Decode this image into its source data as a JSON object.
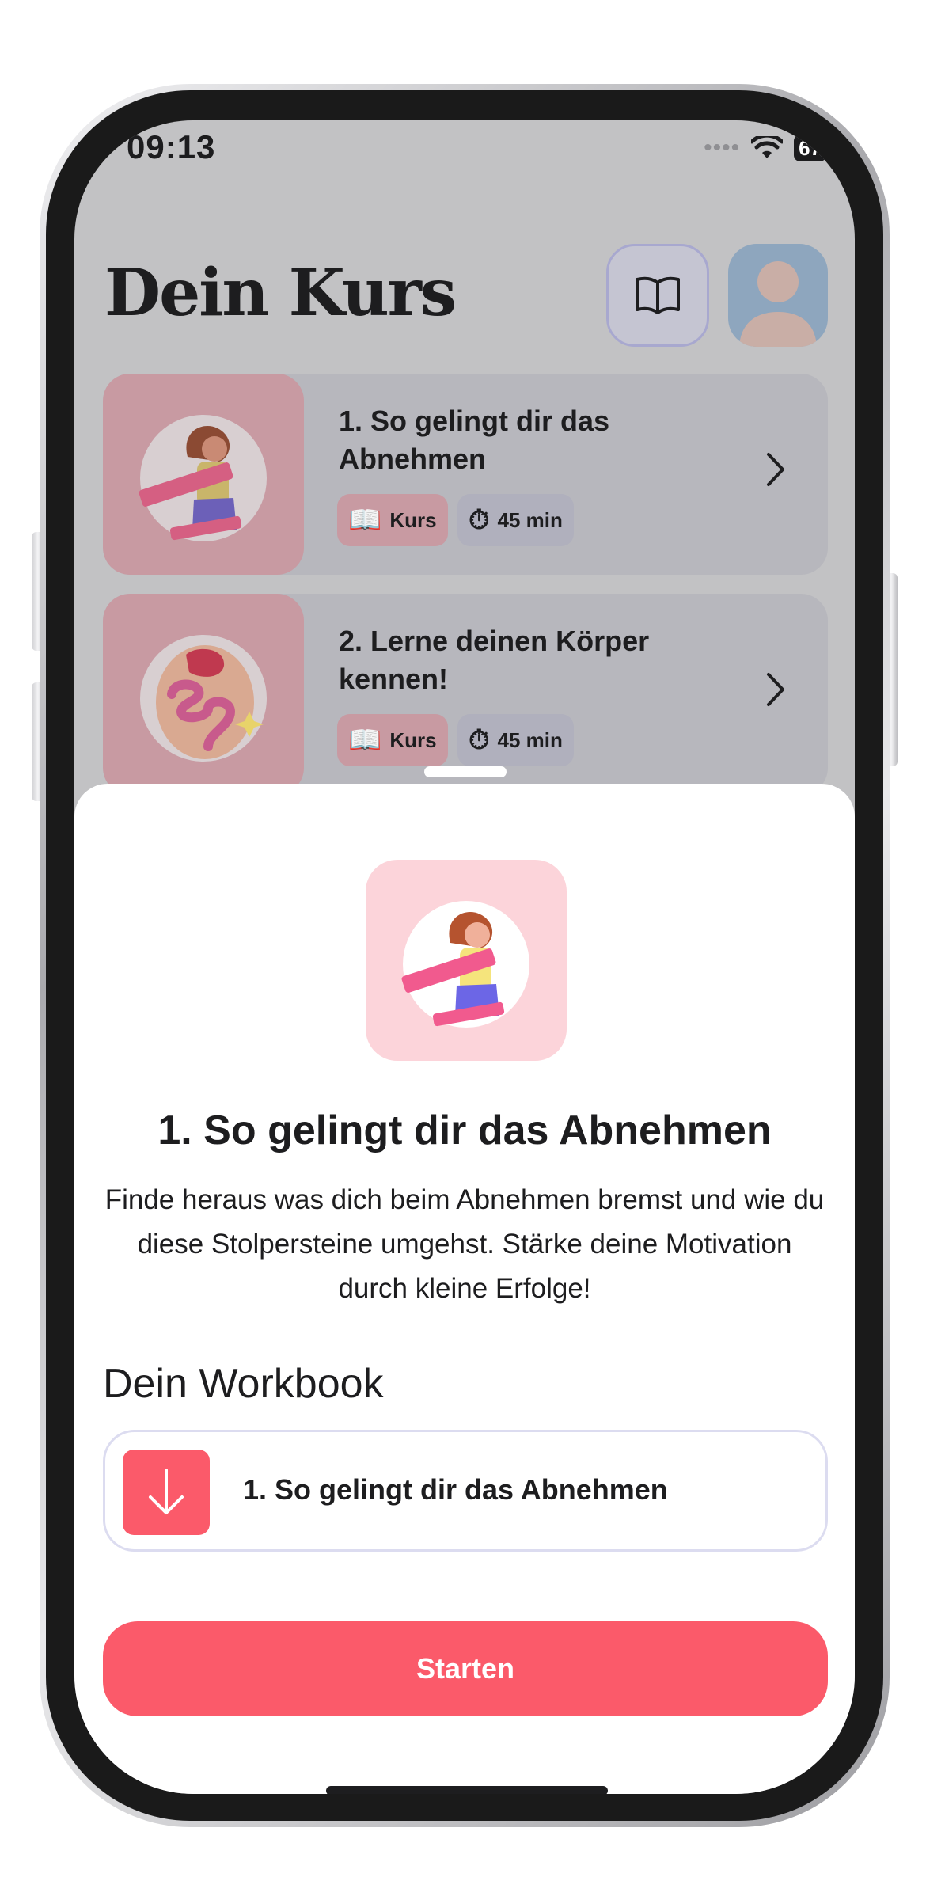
{
  "status": {
    "time": "09:13",
    "battery": "67"
  },
  "header": {
    "title": "Dein Kurs"
  },
  "courses": [
    {
      "title": "1. So gelingt dir das Abnehmen",
      "type_label": "Kurs",
      "duration": "45 min"
    },
    {
      "title": "2. Lerne deinen Körper kennen!",
      "type_label": "Kurs",
      "duration": "45 min"
    }
  ],
  "sheet": {
    "title": "1. So gelingt dir das Abnehmen",
    "description": "Finde heraus was dich beim Abnehmen bremst und wie du diese Stolpersteine umgehst. Stärke deine Motivation durch kleine Erfolge!",
    "workbook_section": "Dein Workbook",
    "workbook_item": "1. So gelingt dir das Abnehmen",
    "start_label": "Starten"
  },
  "colors": {
    "accent": "#fb5a6a",
    "thumb_pink": "#fcd4da",
    "text": "#1d1d1f"
  },
  "icons": {
    "book": "book-open-icon",
    "avatar": "user-avatar-icon",
    "chevron": "chevron-right-icon",
    "course_type": "open-book-emoji",
    "duration": "stopwatch-emoji",
    "download": "arrow-down-icon"
  }
}
